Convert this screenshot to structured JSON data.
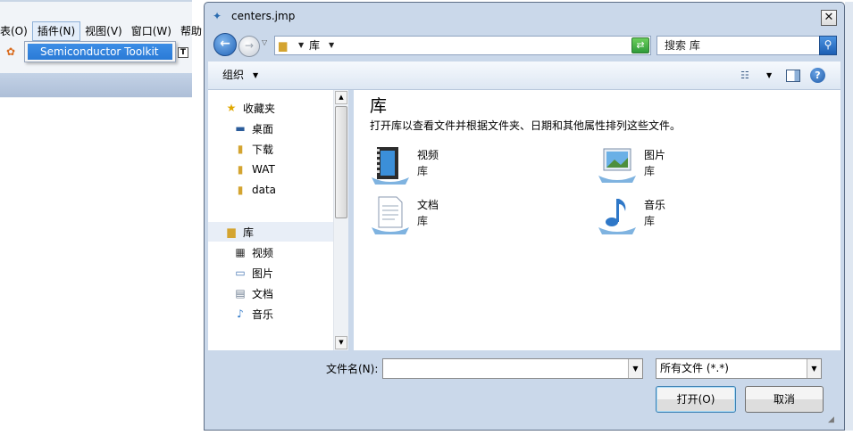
{
  "background_app": {
    "menu": [
      "表(O)",
      "插件(N)",
      "视图(V)",
      "窗口(W)",
      "帮助"
    ],
    "plugin_menu_item": "Semiconductor Toolkit"
  },
  "dialog": {
    "title": "centers.jmp",
    "close_glyph": "✕",
    "address": {
      "crumb": "库"
    },
    "search": {
      "placeholder": "搜索 库"
    },
    "organize_label": "组织",
    "nav": {
      "favorites": "收藏夹",
      "items_fav": [
        "桌面",
        "下载",
        "WAT",
        "data"
      ],
      "libraries": "库",
      "items_lib": [
        "视频",
        "图片",
        "文档",
        "音乐"
      ]
    },
    "content": {
      "title": "库",
      "description": "打开库以查看文件并根据文件夹、日期和其他属性排列这些文件。",
      "libraries": [
        {
          "name": "视频",
          "kind": "库",
          "icon": "video-library-icon"
        },
        {
          "name": "图片",
          "kind": "库",
          "icon": "pictures-library-icon"
        },
        {
          "name": "文档",
          "kind": "库",
          "icon": "documents-library-icon"
        },
        {
          "name": "音乐",
          "kind": "库",
          "icon": "music-library-icon"
        }
      ]
    },
    "filename_label": "文件名(N):",
    "filename_value": "",
    "filetype": "所有文件 (*.*)",
    "open_label": "打开(O)",
    "cancel_label": "取消"
  }
}
